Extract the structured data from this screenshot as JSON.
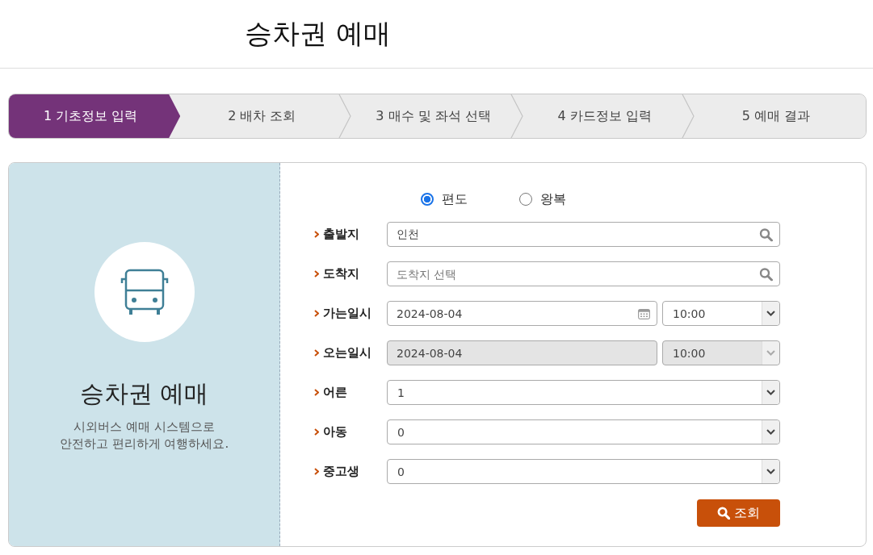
{
  "page_title": "승차권 예매",
  "steps": [
    {
      "label": "1 기초정보 입력",
      "selected": true
    },
    {
      "label": "2 배차 조회",
      "selected": false
    },
    {
      "label": "3 매수 및 좌석 선택",
      "selected": false
    },
    {
      "label": "4 카드정보 입력",
      "selected": false
    },
    {
      "label": "5 예매 결과",
      "selected": false
    }
  ],
  "intro": {
    "title": "승차권 예매",
    "description_lines": [
      "시외버스 예매 시스템으로",
      "안전하고 편리하게 여행하세요."
    ]
  },
  "trip_type": [
    {
      "label": "편도",
      "selected": true
    },
    {
      "label": "왕복",
      "selected": false
    }
  ],
  "fields": [
    {
      "kind": "search",
      "label": "출발지",
      "value": "인천"
    },
    {
      "kind": "search",
      "label": "도착지",
      "placeholder": "도착지 선택"
    },
    {
      "kind": "datetime",
      "label": "가는일시",
      "date": "2024-08-04",
      "time": "10:00",
      "disabled": false
    },
    {
      "kind": "datetime",
      "label": "오는일시",
      "date": "2024-08-04",
      "time": "10:00",
      "disabled": true
    },
    {
      "kind": "select",
      "label": "어른",
      "value": "1"
    },
    {
      "kind": "select",
      "label": "아동",
      "value": "0"
    },
    {
      "kind": "select",
      "label": "중고생",
      "value": "0"
    }
  ],
  "search_button": "조회"
}
